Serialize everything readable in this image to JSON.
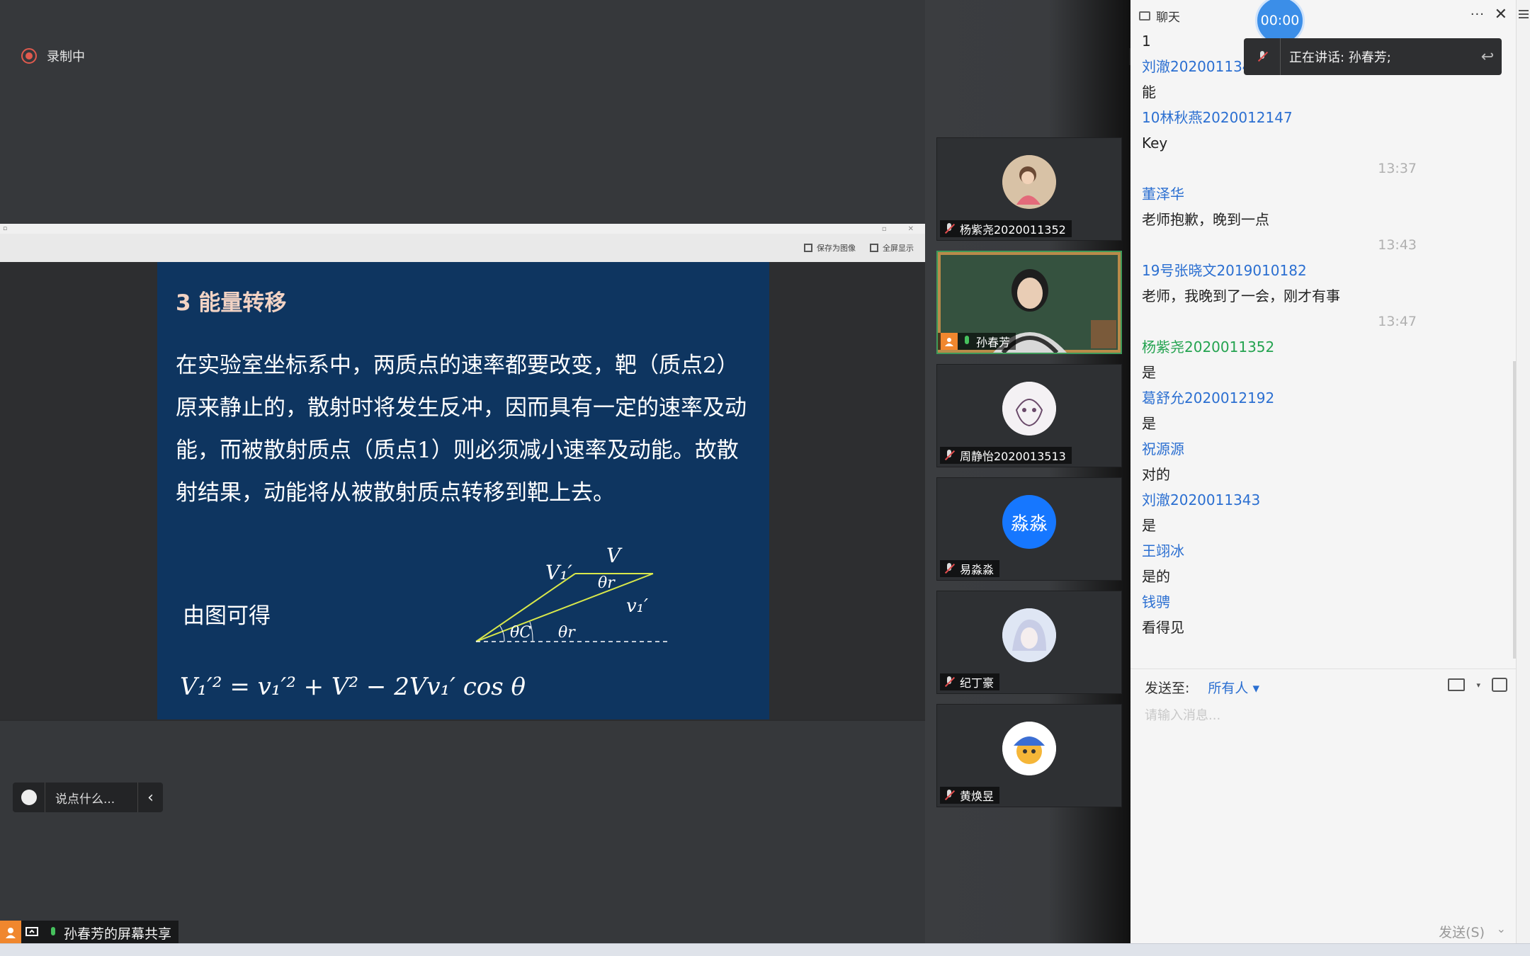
{
  "recording": {
    "label": "录制中"
  },
  "share_window": {
    "toolbar": {
      "save_label": "保存为图像",
      "fullscreen_label": "全屏显示"
    }
  },
  "slide": {
    "title": "3 能量转移",
    "body": "在实验室坐标系中，两质点的速率都要改变，靶（质点2）原来静止的，散射时将发生反冲，因而具有一定的速率及动能，而被散射质点（质点1）则必须减小速率及动能。故散射结果，动能将从被散射质点转移到靶上去。",
    "subtitle": "由图可得",
    "formula": "V₁′² = v₁′² + V² − 2Vv₁′ cos θ",
    "diagram_labels": {
      "V": "V",
      "V1p": "V₁′",
      "v1p": "v₁′",
      "theta_r_top": "θr",
      "theta_c": "θC",
      "theta_r": "θr"
    }
  },
  "comment_pill": {
    "placeholder": "说点什么..."
  },
  "share_label": {
    "text": "孙春芳的屏幕共享"
  },
  "participants": [
    {
      "name": "杨紫尧2020011352",
      "avatar": "avatar-cartoon-girl"
    },
    {
      "name": "孙春芳",
      "avatar": "video",
      "speaking": true
    },
    {
      "name": "周静怡2020013513",
      "avatar": "avatar-sketch"
    },
    {
      "name": "易淼淼",
      "avatar_text": "淼淼",
      "avatar_color": "#1677ff"
    },
    {
      "name": "纪丁豪",
      "avatar": "avatar-anime"
    },
    {
      "name": "黄焕昱",
      "avatar": "avatar-emoji"
    }
  ],
  "chat": {
    "title": "聊天",
    "messages": [
      {
        "type": "content",
        "text": "1"
      },
      {
        "type": "sender",
        "text": "刘澈2020011343"
      },
      {
        "type": "content",
        "text": "能"
      },
      {
        "type": "sender",
        "text": "10林秋燕2020012147"
      },
      {
        "type": "content",
        "text": "Key"
      },
      {
        "type": "time",
        "text": "13:37"
      },
      {
        "type": "sender",
        "text": "董泽华"
      },
      {
        "type": "content",
        "text": "老师抱歉，晚到一点"
      },
      {
        "type": "time",
        "text": "13:43"
      },
      {
        "type": "sender",
        "text": "19号张晓文2019010182"
      },
      {
        "type": "content",
        "text": "老师，我晚到了一会，刚才有事"
      },
      {
        "type": "time",
        "text": "13:47"
      },
      {
        "type": "sender",
        "text": "杨紫尧2020011352",
        "self": true
      },
      {
        "type": "content",
        "text": "是"
      },
      {
        "type": "sender",
        "text": "葛舒允2020012192"
      },
      {
        "type": "content",
        "text": "是"
      },
      {
        "type": "sender",
        "text": "祝源源"
      },
      {
        "type": "content",
        "text": "对的"
      },
      {
        "type": "sender",
        "text": "刘澈2020011343"
      },
      {
        "type": "content",
        "text": "是"
      },
      {
        "type": "sender",
        "text": "王翊冰"
      },
      {
        "type": "content",
        "text": "是的"
      },
      {
        "type": "sender",
        "text": "钱骋"
      },
      {
        "type": "content",
        "text": "看得见"
      }
    ],
    "send_to_label": "发送至:",
    "send_to_target": "所有人",
    "input_placeholder": "请输入消息...",
    "send_button": "发送(S)"
  },
  "timer": {
    "text": "00:00"
  },
  "speaking_toast": {
    "text": "正在讲话: 孙春芳;"
  },
  "colors": {
    "accent_blue": "#2b6fd1",
    "self_green": "#24a350",
    "record_red": "#e05a4e"
  }
}
